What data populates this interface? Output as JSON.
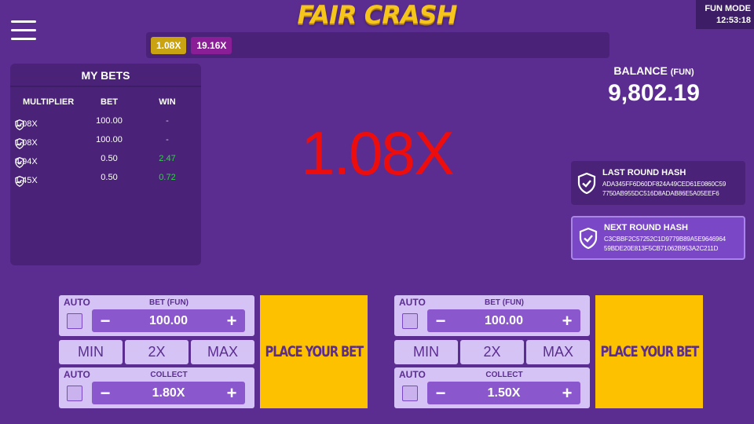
{
  "header": {
    "logo_text": "FAIR CRASH",
    "fun_mode_label": "FUN MODE",
    "clock": "12:53:18"
  },
  "history": [
    {
      "label": "1.08X",
      "color": "#c9a311"
    },
    {
      "label": "19.16X",
      "color": "#8a1e96"
    }
  ],
  "my_bets": {
    "title": "MY BETS",
    "headers": {
      "multiplier": "MULTIPLIER",
      "bet": "BET",
      "win": "WIN"
    },
    "rows": [
      {
        "multiplier": "1.08X",
        "bet": "100.00",
        "win": "-",
        "win_color": "#d9c8f5"
      },
      {
        "multiplier": "1.08X",
        "bet": "100.00",
        "win": "-",
        "win_color": "#d9c8f5"
      },
      {
        "multiplier": "4.94X",
        "bet": "0.50",
        "win": "2.47",
        "win_color": "#34d04a"
      },
      {
        "multiplier": "1.45X",
        "bet": "0.50",
        "win": "0.72",
        "win_color": "#34d04a"
      }
    ]
  },
  "current_multiplier": "1.08X",
  "balance": {
    "label": "BALANCE",
    "unit": "(FUN)",
    "value": "9,802.19"
  },
  "hashes": {
    "last": {
      "title": "LAST ROUND HASH",
      "line1": "ADA345FF6D60DF824A49CED61E0860C59",
      "line2": "7750AB955DC516D8ADAB86E5A05EEF6"
    },
    "next": {
      "title": "NEXT ROUND HASH",
      "line1": "C3CBBF2C57252C1D9779B89A5E9646964",
      "line2": "59BDE20E813F5CB71062B953A2C211D"
    }
  },
  "bet_panels": [
    {
      "auto_label": "AUTO",
      "bet_label": "BET (FUN)",
      "bet_value": "100.00",
      "minus": "−",
      "plus": "+",
      "quick": [
        "MIN",
        "2X",
        "MAX"
      ],
      "collect_auto_label": "AUTO",
      "collect_label": "COLLECT",
      "collect_value": "1.80X",
      "place_label": "PLACE YOUR BET"
    },
    {
      "auto_label": "AUTO",
      "bet_label": "BET (FUN)",
      "bet_value": "100.00",
      "minus": "−",
      "plus": "+",
      "quick": [
        "MIN",
        "2X",
        "MAX"
      ],
      "collect_auto_label": "AUTO",
      "collect_label": "COLLECT",
      "collect_value": "1.50X",
      "place_label": "PLACE YOUR BET"
    }
  ]
}
